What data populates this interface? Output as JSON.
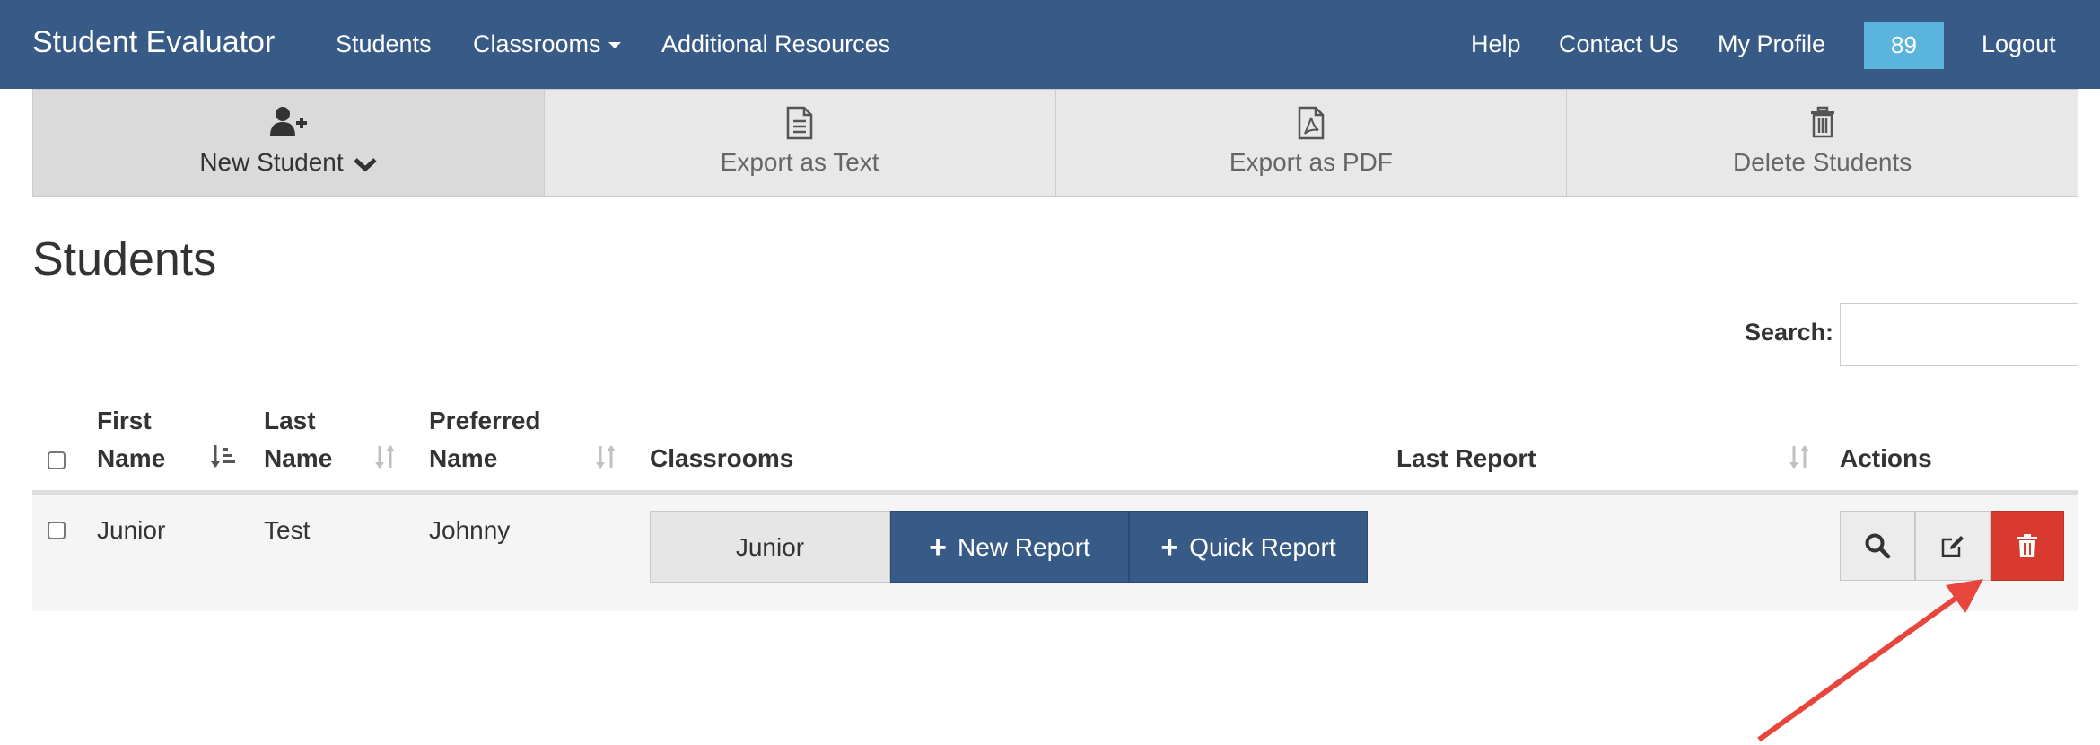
{
  "navbar": {
    "brand": "Student Evaluator",
    "links": {
      "students": "Students",
      "classrooms": "Classrooms",
      "resources": "Additional Resources",
      "help": "Help",
      "contact": "Contact Us",
      "profile": "My Profile",
      "logout": "Logout"
    },
    "badge": "89"
  },
  "toolbar": {
    "new_student": "New Student",
    "export_text": "Export as Text",
    "export_pdf": "Export as PDF",
    "delete_students": "Delete Students"
  },
  "page": {
    "title": "Students",
    "search_label": "Search:",
    "search_value": ""
  },
  "table": {
    "headers": {
      "first_name_1": "First",
      "first_name_2": "Name",
      "last_name_1": "Last",
      "last_name_2": "Name",
      "preferred_name_1": "Preferred",
      "preferred_name_2": "Name",
      "classrooms": "Classrooms",
      "last_report": "Last Report",
      "actions": "Actions"
    },
    "rows": [
      {
        "first_name": "Junior",
        "last_name": "Test",
        "preferred_name": "Johnny",
        "classroom": "Junior",
        "new_report_label": "New Report",
        "quick_report_label": "Quick Report",
        "last_report": ""
      }
    ]
  },
  "colors": {
    "navbar": "#375a86",
    "badge": "#5ab4dc",
    "primary_button": "#375a86",
    "danger_button": "#d93a2f",
    "annotation_arrow": "#e8453c"
  },
  "icons": {
    "new_student": "user-plus-icon",
    "export_text": "file-text-icon",
    "export_pdf": "file-pdf-icon",
    "delete_students": "trash-icon",
    "view": "search-icon",
    "edit": "edit-icon",
    "delete": "trash-icon"
  }
}
